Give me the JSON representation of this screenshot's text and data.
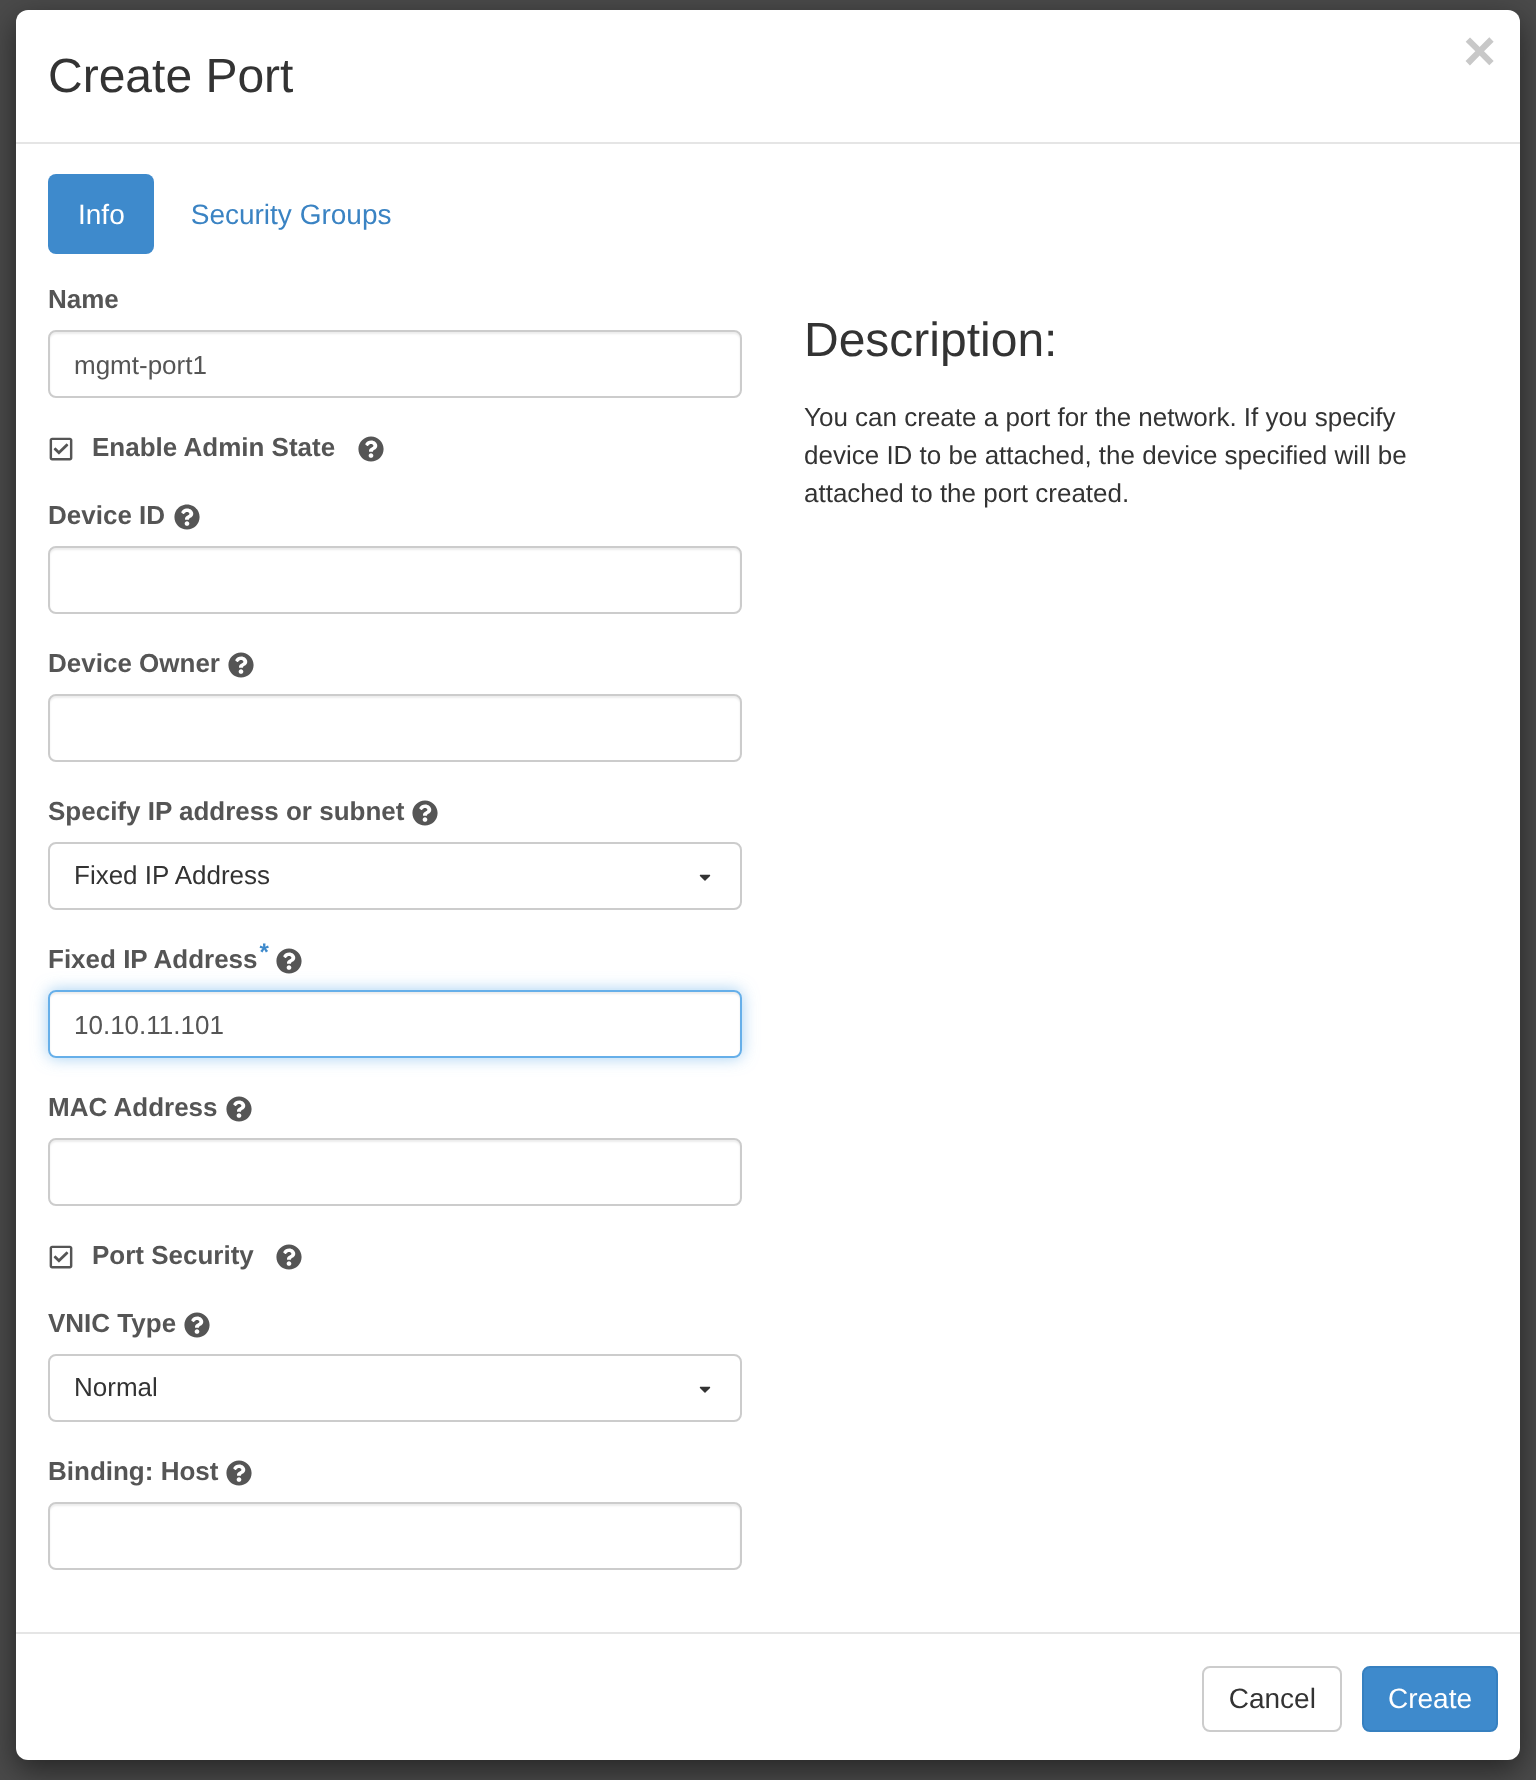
{
  "dialog": {
    "title": "Create Port",
    "close": "×"
  },
  "tabs": [
    {
      "label": "Info",
      "selected": true
    },
    {
      "label": "Security Groups",
      "selected": false
    }
  ],
  "fields": [
    {
      "kind": "text",
      "label": "Name",
      "help": false,
      "value": "mgmt-port1"
    },
    {
      "kind": "checkbox",
      "label": "Enable Admin State",
      "help": true,
      "checked": true
    },
    {
      "kind": "text",
      "label": "Device ID",
      "help": true
    },
    {
      "kind": "text",
      "label": "Device Owner",
      "help": true
    },
    {
      "kind": "select",
      "label": "Specify IP address or subnet",
      "help": true,
      "value": "Fixed IP Address"
    },
    {
      "kind": "text",
      "label": "Fixed IP Address",
      "required_mark": "*",
      "help": true,
      "value": "10.10.11.101",
      "focused": true
    },
    {
      "kind": "text",
      "label": "MAC Address",
      "help": true
    },
    {
      "kind": "checkbox",
      "label": "Port Security",
      "help": true,
      "checked": true
    },
    {
      "kind": "select",
      "label": "VNIC Type",
      "help": true,
      "value": "Normal"
    },
    {
      "kind": "text",
      "label": "Binding: Host",
      "help": true
    }
  ],
  "description": {
    "heading": "Description:",
    "text": "You can create a port for the network. If you specify device ID to be attached, the device specified will be attached to the port created."
  },
  "buttons": [
    {
      "label": "Cancel",
      "kind": "secondary"
    },
    {
      "label": "Create",
      "kind": "primary"
    }
  ]
}
